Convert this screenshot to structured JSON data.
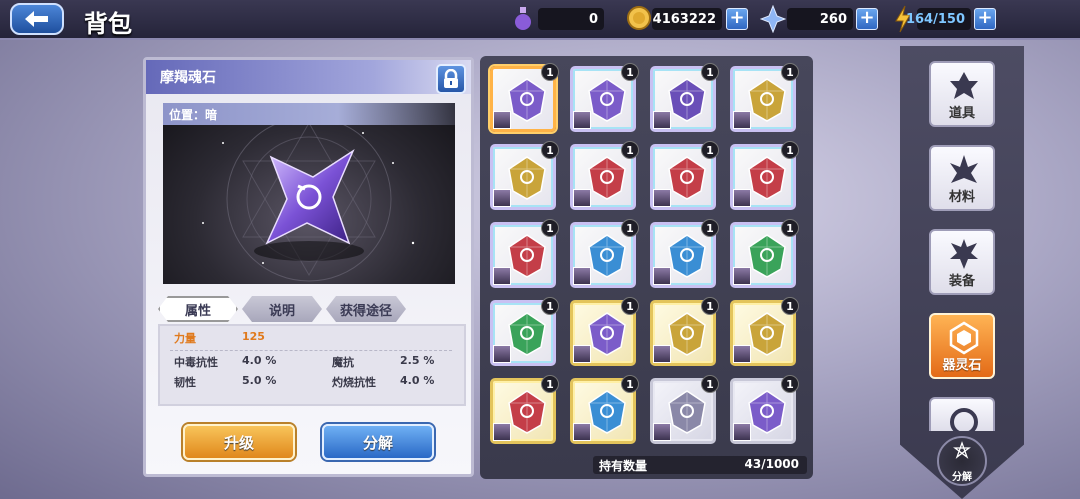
{
  "header": {
    "title": "背包",
    "resources": {
      "potion": "0",
      "gold": "4163222",
      "crystal": "260",
      "energy": "164/150"
    }
  },
  "detail": {
    "item_name": "摩羯魂石",
    "position_label": "位置：暗",
    "tabs": [
      "属性",
      "说明",
      "获得途径"
    ],
    "stats": {
      "strength_label": "力量",
      "strength_value": "125",
      "rows": [
        {
          "label": "中毒抗性",
          "value": "4.0 %"
        },
        {
          "label": "魔抗",
          "value": "2.5 %"
        },
        {
          "label": "韧性",
          "value": "5.0 %"
        },
        {
          "label": "灼烧抗性",
          "value": "4.0 %"
        }
      ]
    },
    "upgrade_label": "升级",
    "decompose_label": "分解"
  },
  "grid": {
    "slots": [
      {
        "color": "#7b5cc9",
        "count": "1",
        "frame": "selected"
      },
      {
        "color": "#7b5cc9",
        "count": "1",
        "frame": "rainbow"
      },
      {
        "color": "#6a4fb8",
        "count": "1",
        "frame": "rainbow"
      },
      {
        "color": "#c9a43a",
        "count": "1",
        "frame": "rainbow"
      },
      {
        "color": "#c9a43a",
        "count": "1",
        "frame": "rainbow"
      },
      {
        "color": "#c43e48",
        "count": "1",
        "frame": "rainbow"
      },
      {
        "color": "#c43e48",
        "count": "1",
        "frame": "rainbow"
      },
      {
        "color": "#c43e48",
        "count": "1",
        "frame": "rainbow"
      },
      {
        "color": "#c43e48",
        "count": "1",
        "frame": "rainbow"
      },
      {
        "color": "#3a8ed4",
        "count": "1",
        "frame": "rainbow"
      },
      {
        "color": "#3a8ed4",
        "count": "1",
        "frame": "rainbow"
      },
      {
        "color": "#3aa35a",
        "count": "1",
        "frame": "rainbow"
      },
      {
        "color": "#3aa35a",
        "count": "1",
        "frame": "rainbow"
      },
      {
        "color": "#7b5cc9",
        "count": "1",
        "frame": "gold"
      },
      {
        "color": "#c9a43a",
        "count": "1",
        "frame": "gold"
      },
      {
        "color": "#c9a43a",
        "count": "1",
        "frame": "gold"
      },
      {
        "color": "#c43e48",
        "count": "1",
        "frame": "gold"
      },
      {
        "color": "#3a8ed4",
        "count": "1",
        "frame": "gold"
      },
      {
        "color": "#8a88a8",
        "count": "1",
        "frame": "silver"
      },
      {
        "color": "#7b5cc9",
        "count": "1",
        "frame": "silver"
      }
    ],
    "footer_label": "持有数量",
    "footer_value": "43/1000"
  },
  "categories": [
    {
      "label": "道具",
      "icon": "item-icon",
      "active": false
    },
    {
      "label": "材料",
      "icon": "material-icon",
      "active": false
    },
    {
      "label": "装备",
      "icon": "equipment-icon",
      "active": false
    },
    {
      "label": "器灵石",
      "icon": "soul-stone-icon",
      "active": true
    }
  ],
  "side_decompose_label": "分解"
}
